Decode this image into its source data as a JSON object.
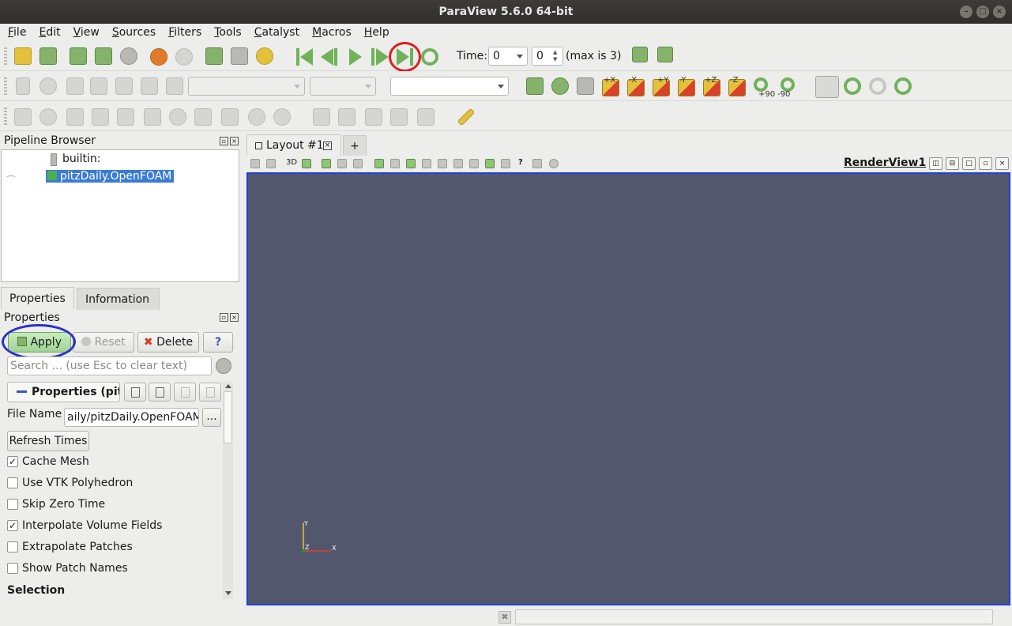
{
  "window": {
    "title": "ParaView 5.6.0 64-bit",
    "controls": [
      "–",
      "□",
      "×"
    ]
  },
  "menubar": {
    "items": [
      "File",
      "Edit",
      "View",
      "Sources",
      "Filters",
      "Tools",
      "Catalyst",
      "Macros",
      "Help"
    ]
  },
  "toolbar1": {
    "file_icons": [
      "open-folder-icon",
      "load-state-icon",
      "save-data-icon",
      "save-state-icon",
      "auto-apply-icon",
      "undo-icon",
      "redo-icon",
      "reset-camera-icon",
      "capture-icon",
      "color-palette-icon"
    ],
    "vcr_icons": [
      "first-frame-icon",
      "previous-frame-icon",
      "play-icon",
      "next-frame-icon",
      "last-frame-icon",
      "loop-icon"
    ],
    "time_label": "Time:",
    "time_value": "0",
    "time_index": "0",
    "max_label": "(max is 3)",
    "extra_icons": [
      "find-data-icon",
      "query-icon"
    ]
  },
  "toolbar2": {
    "camera_labels": [
      "+X",
      "-X",
      "+Y",
      "-Y",
      "+Z",
      "-Z",
      "+90",
      "-90"
    ],
    "combo_representation": "",
    "combo_coloring": "",
    "combo_variable": ""
  },
  "pipeline": {
    "title": "Pipeline Browser",
    "items": [
      {
        "label": "builtin:",
        "selected": false
      },
      {
        "label": "pitzDaily.OpenFOAM",
        "selected": true
      }
    ]
  },
  "tabs": {
    "properties": "Properties",
    "information": "Information"
  },
  "properties_panel": {
    "title": "Properties",
    "apply": "Apply",
    "reset": "Reset",
    "delete": "Delete",
    "help": "?",
    "search_placeholder": "Search ... (use Esc to clear text)",
    "group_title": "Properties (pitzDaily.OpenFOAM)",
    "file_name_label": "File Name",
    "file_name_value": "aily/pitzDaily.OpenFOAM",
    "browse": "...",
    "refresh_times": "Refresh Times",
    "options": [
      {
        "label": "Cache Mesh",
        "checked": true
      },
      {
        "label": "Use VTK Polyhedron",
        "checked": false
      },
      {
        "label": "Skip Zero Time",
        "checked": false
      },
      {
        "label": "Interpolate Volume Fields",
        "checked": true
      },
      {
        "label": "Extrapolate Patches",
        "checked": false
      },
      {
        "label": "Show Patch Names",
        "checked": false
      }
    ],
    "section_selection": "Selection"
  },
  "layout": {
    "tab_label": "Layout #1",
    "new_tab": "+",
    "view_name": "RenderView1",
    "view_mode": "3D",
    "help_marker": "?"
  },
  "render_view": {
    "background": "#52576e",
    "axes": {
      "x": "X",
      "y": "Y",
      "z": "Z"
    }
  },
  "colors": {
    "accent_green": "#9ed394",
    "selection_blue": "#3a7bd5",
    "highlight_red": "#e31a1a",
    "highlight_blue": "#2b2fcf"
  }
}
